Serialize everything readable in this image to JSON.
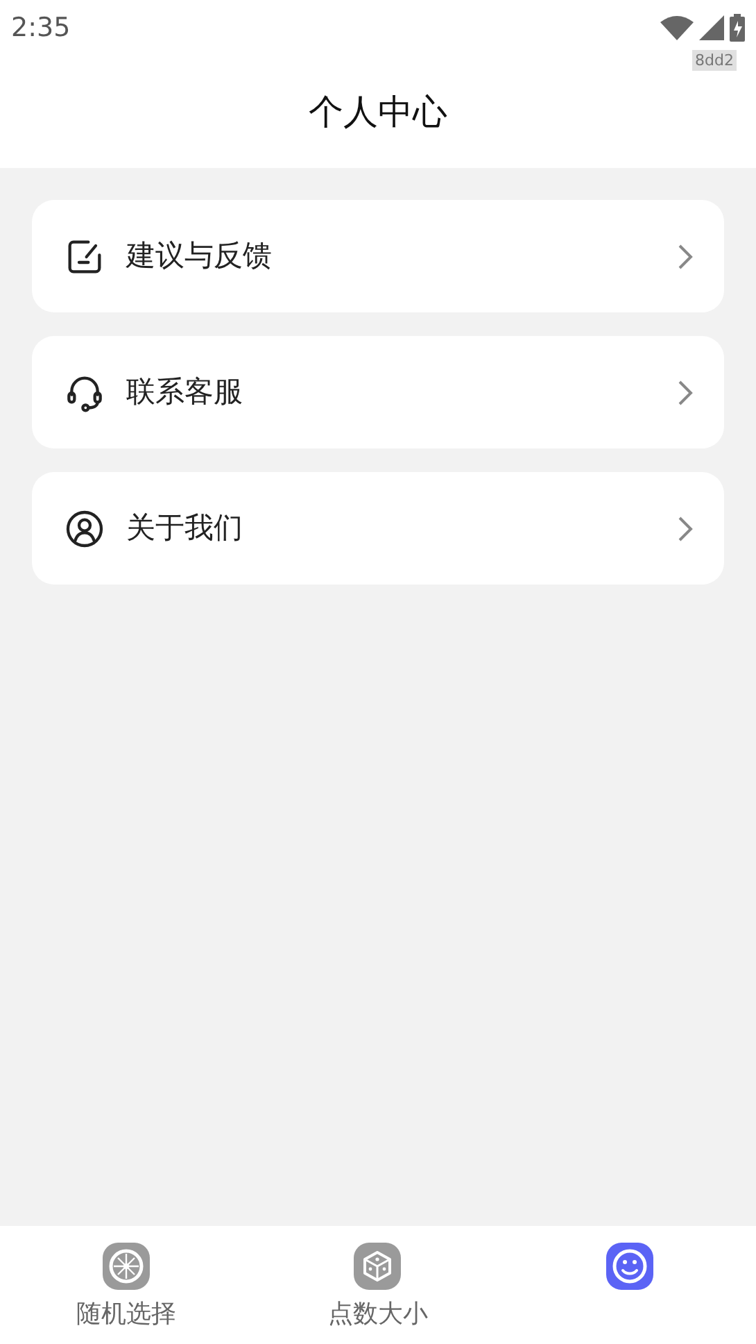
{
  "status_bar": {
    "time": "2:35",
    "tag": "8dd2"
  },
  "header": {
    "title": "个人中心"
  },
  "menu_items": [
    {
      "kind": "feedback",
      "label": "建议与反馈"
    },
    {
      "kind": "support",
      "label": "联系客服"
    },
    {
      "kind": "about",
      "label": "关于我们"
    }
  ],
  "tab_bar": [
    {
      "kind": "wheel",
      "label": "随机选择",
      "selected": false
    },
    {
      "kind": "dice",
      "label": "点数大小",
      "selected": false
    },
    {
      "kind": "profile",
      "selected": true
    }
  ]
}
